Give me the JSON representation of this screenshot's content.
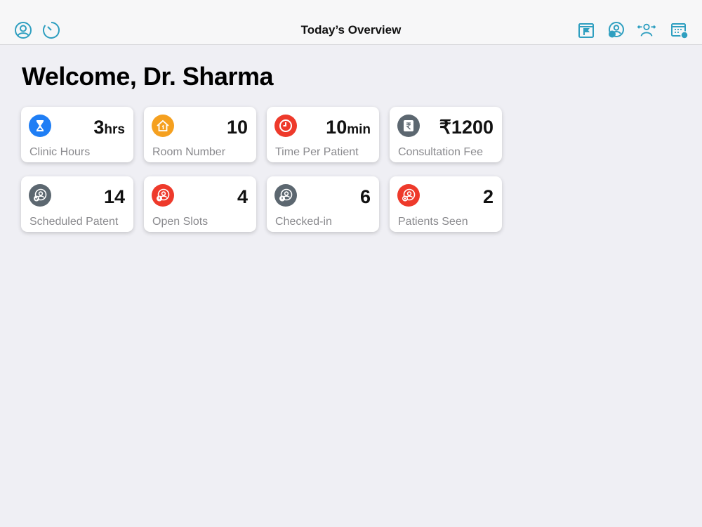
{
  "nav": {
    "title": "Today’s Overview",
    "left_icons": [
      "profile-icon",
      "timer-icon"
    ],
    "right_icons": [
      "flag-calendar-icon",
      "patient-search-icon",
      "patient-transfer-icon",
      "calendar-user-icon"
    ],
    "accent_color": "#2f9fc0"
  },
  "welcome": "Welcome, Dr. Sharma",
  "cards": [
    {
      "icon": "hourglass-icon",
      "icon_color": "#1f7ef5",
      "value": "3",
      "unit": "hrs",
      "label": "Clinic Hours"
    },
    {
      "icon": "home-icon",
      "icon_color": "#f5a01f",
      "value": "10",
      "unit": "",
      "label": "Room Number"
    },
    {
      "icon": "clock-icon",
      "icon_color": "#ee3a2b",
      "value": "10",
      "unit": "min",
      "label": "Time Per Patient"
    },
    {
      "icon": "rupee-icon",
      "icon_color": "#5c6770",
      "value": "₹1200",
      "unit": "",
      "label": "Consultation Fee"
    },
    {
      "icon": "scheduled-patient-icon",
      "icon_color": "#5c6770",
      "value": "14",
      "unit": "",
      "label": "Scheduled Patent"
    },
    {
      "icon": "open-slots-icon",
      "icon_color": "#ee3a2b",
      "value": "4",
      "unit": "",
      "label": "Open Slots"
    },
    {
      "icon": "checked-in-icon",
      "icon_color": "#5c6770",
      "value": "6",
      "unit": "",
      "label": "Checked-in"
    },
    {
      "icon": "patients-seen-icon",
      "icon_color": "#ee3a2b",
      "value": "2",
      "unit": "",
      "label": "Patients Seen"
    }
  ]
}
